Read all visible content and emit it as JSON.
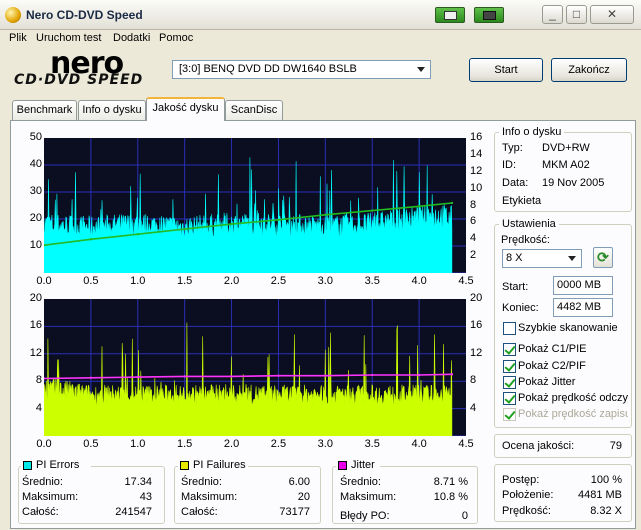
{
  "window": {
    "title": "Nero CD-DVD Speed",
    "minimize": "_",
    "maximize": "□",
    "close": "✕"
  },
  "menu": [
    "Plik",
    "Uruchom test",
    "Dodatki",
    "Pomoc"
  ],
  "logo": {
    "main": "nero",
    "sub": "CD·DVD SPEED"
  },
  "drive": {
    "selected": "[3:0]  BENQ DVD DD DW1640 BSLB"
  },
  "buttons": {
    "start": "Start",
    "exit": "Zakończ"
  },
  "tabs": [
    "Benchmark",
    "Info o dysku",
    "Jakość dysku",
    "ScanDisc"
  ],
  "active_tab": 2,
  "disc_info": {
    "title": "Info o dysku",
    "rows": [
      {
        "label": "Typ:",
        "value": "DVD+RW"
      },
      {
        "label": "ID:",
        "value": "MKM A02"
      },
      {
        "label": "Data:",
        "value": "19 Nov 2005"
      }
    ],
    "label_field": "Etykieta"
  },
  "settings": {
    "title": "Ustawienia",
    "speed_label": "Prędkość:",
    "speed_value": "8 X",
    "start_label": "Start:",
    "start_value": "0000 MB",
    "end_label": "Koniec:",
    "end_value": "4482 MB",
    "checkboxes": [
      {
        "label": "Szybkie skanowanie",
        "checked": false,
        "enabled": true
      },
      {
        "label": "Pokaż C1/PIE",
        "checked": true,
        "enabled": true
      },
      {
        "label": "Pokaż C2/PIF",
        "checked": true,
        "enabled": true
      },
      {
        "label": "Pokaż Jitter",
        "checked": true,
        "enabled": true
      },
      {
        "label": "Pokaż prędkość odczy",
        "checked": true,
        "enabled": true
      },
      {
        "label": "Pokaż prędkość zapisu",
        "checked": true,
        "enabled": false
      }
    ]
  },
  "quality": {
    "label": "Ocena jakości:",
    "value": "79"
  },
  "progress": {
    "rows": [
      {
        "label": "Postęp:",
        "value": "100 %"
      },
      {
        "label": "Położenie:",
        "value": "4481 MB"
      },
      {
        "label": "Prędkość:",
        "value": "8.32 X"
      }
    ]
  },
  "stats": {
    "pie": {
      "title": "PI Errors",
      "color": "#00e8e8",
      "rows": [
        {
          "label": "Średnio:",
          "value": "17.34"
        },
        {
          "label": "Maksimum:",
          "value": "43"
        },
        {
          "label": "Całość:",
          "value": "241547"
        }
      ]
    },
    "pif": {
      "title": "PI Failures",
      "color": "#e8e800",
      "rows": [
        {
          "label": "Średnio:",
          "value": "6.00"
        },
        {
          "label": "Maksimum:",
          "value": "20"
        },
        {
          "label": "Całość:",
          "value": "73177"
        }
      ]
    },
    "jitter": {
      "title": "Jitter",
      "color": "#e800e8",
      "rows": [
        {
          "label": "Średnio:",
          "value": "8.71 %"
        },
        {
          "label": "Maksimum:",
          "value": "10.8 %"
        },
        {
          "label": "Błędy PO:",
          "value": "0"
        }
      ]
    }
  },
  "chart_data": [
    {
      "type": "area",
      "x_ticks": [
        "0.0",
        "0.5",
        "1.0",
        "1.5",
        "2.0",
        "2.5",
        "3.0",
        "3.5",
        "4.0",
        "4.5"
      ],
      "y_left_ticks": [
        "50",
        "40",
        "30",
        "20",
        "10"
      ],
      "y_right_ticks": [
        "16",
        "14",
        "12",
        "10",
        "8",
        "6",
        "4",
        "2"
      ],
      "xlim": [
        0,
        4.5
      ],
      "ylim_left": [
        0,
        50
      ],
      "ylim_right": [
        0,
        16
      ],
      "grid": true,
      "series": [
        {
          "name": "PI Errors",
          "color": "#00ffff",
          "x": [
            0,
            0.5,
            1.0,
            1.5,
            2.0,
            2.5,
            3.0,
            3.5,
            4.0,
            4.2,
            4.35
          ],
          "y": [
            18,
            17,
            18,
            17,
            18,
            18,
            17,
            18,
            20,
            21,
            20
          ]
        },
        {
          "name": "Read speed",
          "color": "#22bb22",
          "x": [
            0,
            0.5,
            1.0,
            1.5,
            2.0,
            2.5,
            3.0,
            3.5,
            4.0,
            4.35
          ],
          "y": [
            3.3,
            4.0,
            4.6,
            5.2,
            5.8,
            6.3,
            6.9,
            7.4,
            7.9,
            8.3
          ]
        }
      ]
    },
    {
      "type": "area",
      "x_ticks": [
        "0.0",
        "0.5",
        "1.0",
        "1.5",
        "2.0",
        "2.5",
        "3.0",
        "3.5",
        "4.0",
        "4.5"
      ],
      "y_left_ticks": [
        "20",
        "16",
        "12",
        "8",
        "4"
      ],
      "y_right_ticks": [
        "20",
        "16",
        "12",
        "8",
        "4"
      ],
      "xlim": [
        0,
        4.5
      ],
      "ylim_left": [
        0,
        20
      ],
      "ylim_right": [
        0,
        20
      ],
      "grid": true,
      "series": [
        {
          "name": "PI Failures",
          "color": "#ccff00",
          "x": [
            0,
            0.5,
            1.0,
            1.5,
            2.0,
            2.5,
            3.0,
            3.5,
            4.0,
            4.35
          ],
          "y": [
            7,
            6,
            6,
            6,
            6,
            6,
            6,
            6,
            6,
            6
          ]
        },
        {
          "name": "Jitter",
          "color": "#ff33ff",
          "x": [
            0,
            0.5,
            1.0,
            1.5,
            2.0,
            2.5,
            3.0,
            3.5,
            4.0,
            4.35
          ],
          "y": [
            8.4,
            8.5,
            8.6,
            8.7,
            8.7,
            8.8,
            8.8,
            8.9,
            8.9,
            9.0
          ]
        }
      ]
    }
  ]
}
